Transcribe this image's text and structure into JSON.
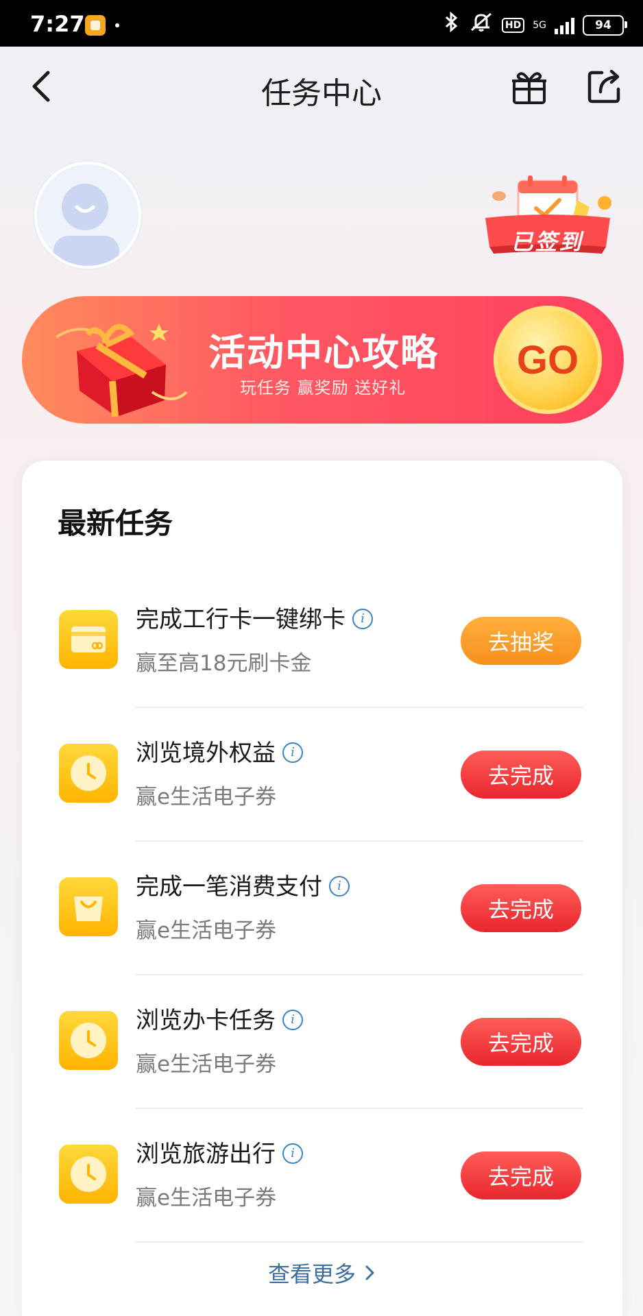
{
  "status_bar": {
    "time": "7:27",
    "network": "5G",
    "hd": "HD",
    "battery": "94"
  },
  "header": {
    "title": "任务中心"
  },
  "profile": {
    "checkin_label": "已签到"
  },
  "banner": {
    "title": "活动中心攻略",
    "subtitle": "玩任务 赢奖励 送好礼",
    "go_label": "GO"
  },
  "tasks_section": {
    "title": "最新任务",
    "tasks": [
      {
        "name": "完成工行卡一键绑卡",
        "desc": "赢至高18元刷卡金",
        "button": "去抽奖",
        "icon": "card-icon",
        "button_color": "#f7901e"
      },
      {
        "name": "浏览境外权益",
        "desc": "赢e生活电子券",
        "button": "去完成",
        "icon": "clock-icon",
        "button_color": "#e8262f"
      },
      {
        "name": "完成一笔消费支付",
        "desc": "赢e生活电子券",
        "button": "去完成",
        "icon": "shopping-bag-icon",
        "button_color": "#e8262f"
      },
      {
        "name": "浏览办卡任务",
        "desc": "赢e生活电子券",
        "button": "去完成",
        "icon": "clock-icon",
        "button_color": "#e8262f"
      },
      {
        "name": "浏览旅游出行",
        "desc": "赢e生活电子券",
        "button": "去完成",
        "icon": "clock-icon",
        "button_color": "#e8262f"
      }
    ],
    "more_label": "查看更多",
    "info_glyph": "i"
  }
}
